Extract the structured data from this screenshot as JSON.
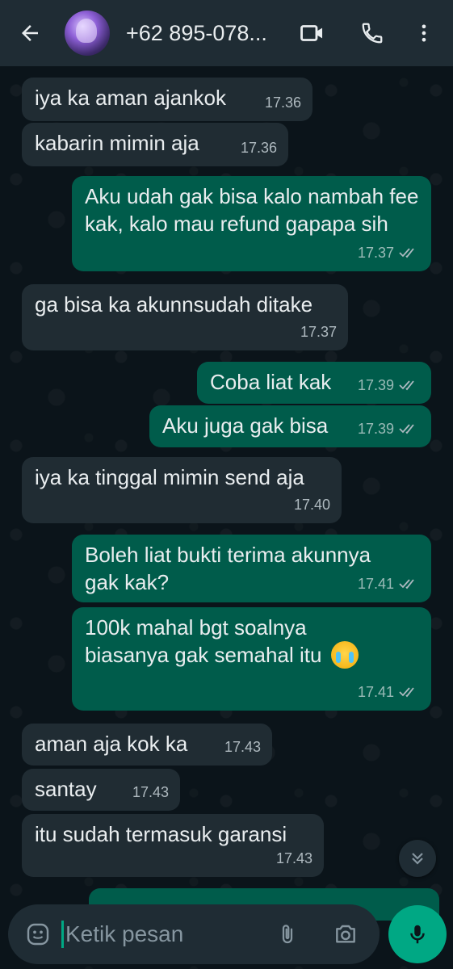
{
  "header": {
    "contact_name": "+62 895-078...",
    "icons": [
      "back-arrow-icon",
      "video-call-icon",
      "phone-icon",
      "more-options-icon"
    ]
  },
  "messages": [
    {
      "dir": "in",
      "text": "iya ka aman ajankok",
      "time": "17.36"
    },
    {
      "dir": "in",
      "text": "kabarin mimin aja",
      "time": "17.36"
    },
    {
      "dir": "out",
      "text": "Aku udah gak bisa kalo nambah fee kak, kalo mau refund gapapa sih",
      "time": "17.37",
      "status": "read"
    },
    {
      "dir": "in",
      "text": "ga bisa ka akunnsudah ditake",
      "time": "17.37"
    },
    {
      "dir": "out",
      "text": "Coba liat kak",
      "time": "17.39",
      "status": "read"
    },
    {
      "dir": "out",
      "text": "Aku juga gak bisa",
      "time": "17.39",
      "status": "read"
    },
    {
      "dir": "in",
      "text": "iya ka tinggal mimin send aja",
      "time": "17.40"
    },
    {
      "dir": "out",
      "text": "Boleh liat bukti terima akunnya gak kak?",
      "time": "17.41",
      "status": "read"
    },
    {
      "dir": "out",
      "text": "100k mahal bgt soalnya biasanya gak semahal itu",
      "emoji": "loudly-crying-face",
      "time": "17.41",
      "status": "read"
    },
    {
      "dir": "in",
      "text": "aman aja kok ka",
      "time": "17.43"
    },
    {
      "dir": "in",
      "text": "santay",
      "time": "17.43"
    },
    {
      "dir": "in",
      "text": "itu sudah termasuk garansi",
      "time": "17.43"
    }
  ],
  "composer": {
    "placeholder": "Ketik pesan",
    "icons": [
      "emoji-icon",
      "attach-icon",
      "camera-icon",
      "mic-icon"
    ]
  },
  "colors": {
    "background": "#0b141a",
    "header": "#1f2c34",
    "incoming_bubble": "#202c33",
    "outgoing_bubble": "#005c4b",
    "accent": "#00a884"
  }
}
